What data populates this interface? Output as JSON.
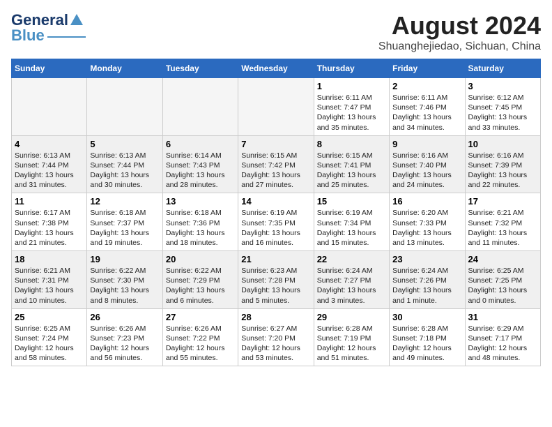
{
  "header": {
    "logo_general": "General",
    "logo_blue": "Blue",
    "month_title": "August 2024",
    "location": "Shuanghejiedao, Sichuan, China"
  },
  "days_of_week": [
    "Sunday",
    "Monday",
    "Tuesday",
    "Wednesday",
    "Thursday",
    "Friday",
    "Saturday"
  ],
  "weeks": [
    [
      {
        "day": "",
        "info": ""
      },
      {
        "day": "",
        "info": ""
      },
      {
        "day": "",
        "info": ""
      },
      {
        "day": "",
        "info": ""
      },
      {
        "day": "1",
        "info": "Sunrise: 6:11 AM\nSunset: 7:47 PM\nDaylight: 13 hours\nand 35 minutes."
      },
      {
        "day": "2",
        "info": "Sunrise: 6:11 AM\nSunset: 7:46 PM\nDaylight: 13 hours\nand 34 minutes."
      },
      {
        "day": "3",
        "info": "Sunrise: 6:12 AM\nSunset: 7:45 PM\nDaylight: 13 hours\nand 33 minutes."
      }
    ],
    [
      {
        "day": "4",
        "info": "Sunrise: 6:13 AM\nSunset: 7:44 PM\nDaylight: 13 hours\nand 31 minutes."
      },
      {
        "day": "5",
        "info": "Sunrise: 6:13 AM\nSunset: 7:44 PM\nDaylight: 13 hours\nand 30 minutes."
      },
      {
        "day": "6",
        "info": "Sunrise: 6:14 AM\nSunset: 7:43 PM\nDaylight: 13 hours\nand 28 minutes."
      },
      {
        "day": "7",
        "info": "Sunrise: 6:15 AM\nSunset: 7:42 PM\nDaylight: 13 hours\nand 27 minutes."
      },
      {
        "day": "8",
        "info": "Sunrise: 6:15 AM\nSunset: 7:41 PM\nDaylight: 13 hours\nand 25 minutes."
      },
      {
        "day": "9",
        "info": "Sunrise: 6:16 AM\nSunset: 7:40 PM\nDaylight: 13 hours\nand 24 minutes."
      },
      {
        "day": "10",
        "info": "Sunrise: 6:16 AM\nSunset: 7:39 PM\nDaylight: 13 hours\nand 22 minutes."
      }
    ],
    [
      {
        "day": "11",
        "info": "Sunrise: 6:17 AM\nSunset: 7:38 PM\nDaylight: 13 hours\nand 21 minutes."
      },
      {
        "day": "12",
        "info": "Sunrise: 6:18 AM\nSunset: 7:37 PM\nDaylight: 13 hours\nand 19 minutes."
      },
      {
        "day": "13",
        "info": "Sunrise: 6:18 AM\nSunset: 7:36 PM\nDaylight: 13 hours\nand 18 minutes."
      },
      {
        "day": "14",
        "info": "Sunrise: 6:19 AM\nSunset: 7:35 PM\nDaylight: 13 hours\nand 16 minutes."
      },
      {
        "day": "15",
        "info": "Sunrise: 6:19 AM\nSunset: 7:34 PM\nDaylight: 13 hours\nand 15 minutes."
      },
      {
        "day": "16",
        "info": "Sunrise: 6:20 AM\nSunset: 7:33 PM\nDaylight: 13 hours\nand 13 minutes."
      },
      {
        "day": "17",
        "info": "Sunrise: 6:21 AM\nSunset: 7:32 PM\nDaylight: 13 hours\nand 11 minutes."
      }
    ],
    [
      {
        "day": "18",
        "info": "Sunrise: 6:21 AM\nSunset: 7:31 PM\nDaylight: 13 hours\nand 10 minutes."
      },
      {
        "day": "19",
        "info": "Sunrise: 6:22 AM\nSunset: 7:30 PM\nDaylight: 13 hours\nand 8 minutes."
      },
      {
        "day": "20",
        "info": "Sunrise: 6:22 AM\nSunset: 7:29 PM\nDaylight: 13 hours\nand 6 minutes."
      },
      {
        "day": "21",
        "info": "Sunrise: 6:23 AM\nSunset: 7:28 PM\nDaylight: 13 hours\nand 5 minutes."
      },
      {
        "day": "22",
        "info": "Sunrise: 6:24 AM\nSunset: 7:27 PM\nDaylight: 13 hours\nand 3 minutes."
      },
      {
        "day": "23",
        "info": "Sunrise: 6:24 AM\nSunset: 7:26 PM\nDaylight: 13 hours\nand 1 minute."
      },
      {
        "day": "24",
        "info": "Sunrise: 6:25 AM\nSunset: 7:25 PM\nDaylight: 13 hours\nand 0 minutes."
      }
    ],
    [
      {
        "day": "25",
        "info": "Sunrise: 6:25 AM\nSunset: 7:24 PM\nDaylight: 12 hours\nand 58 minutes."
      },
      {
        "day": "26",
        "info": "Sunrise: 6:26 AM\nSunset: 7:23 PM\nDaylight: 12 hours\nand 56 minutes."
      },
      {
        "day": "27",
        "info": "Sunrise: 6:26 AM\nSunset: 7:22 PM\nDaylight: 12 hours\nand 55 minutes."
      },
      {
        "day": "28",
        "info": "Sunrise: 6:27 AM\nSunset: 7:20 PM\nDaylight: 12 hours\nand 53 minutes."
      },
      {
        "day": "29",
        "info": "Sunrise: 6:28 AM\nSunset: 7:19 PM\nDaylight: 12 hours\nand 51 minutes."
      },
      {
        "day": "30",
        "info": "Sunrise: 6:28 AM\nSunset: 7:18 PM\nDaylight: 12 hours\nand 49 minutes."
      },
      {
        "day": "31",
        "info": "Sunrise: 6:29 AM\nSunset: 7:17 PM\nDaylight: 12 hours\nand 48 minutes."
      }
    ]
  ]
}
